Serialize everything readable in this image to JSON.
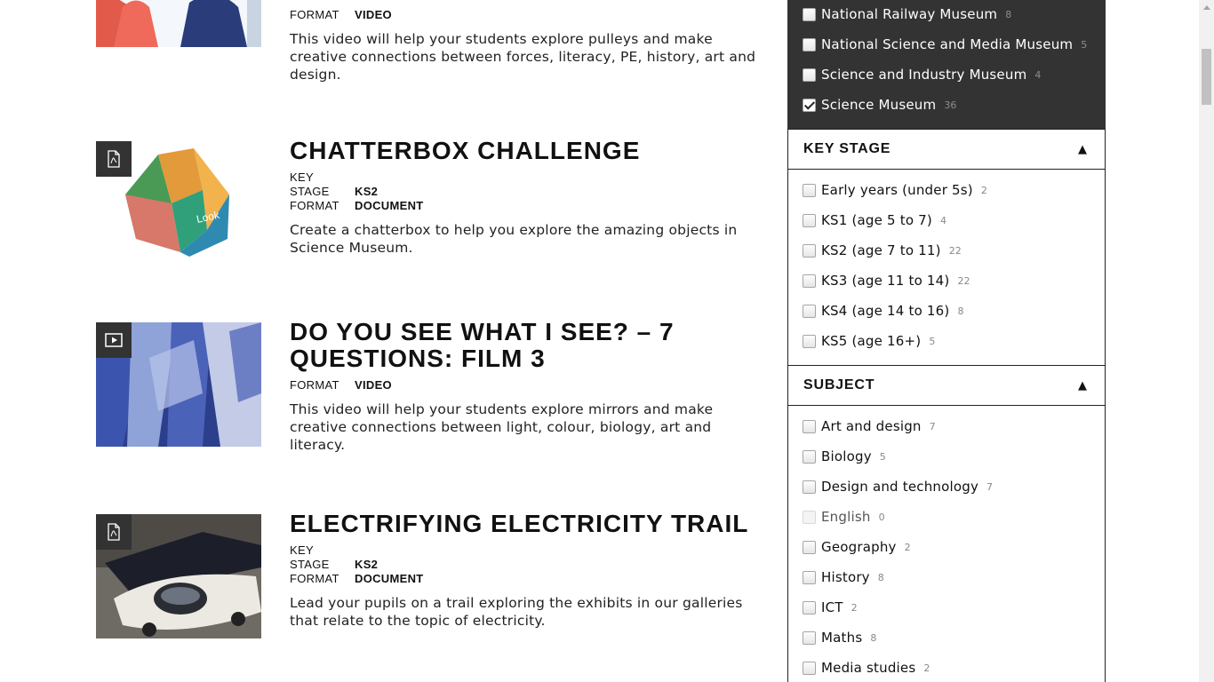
{
  "results": [
    {
      "title": "",
      "format_label": "FORMAT",
      "format": "VIDEO",
      "description": "This video will help your students explore pulleys and make creative connections between forces, literacy, PE, history, art and design."
    },
    {
      "title": "CHATTERBOX CHALLENGE",
      "key_stage_label": "KEY STAGE",
      "key_stage": "KS2",
      "format_label": "FORMAT",
      "format": "DOCUMENT",
      "description": "Create a chatterbox to help you explore the amazing objects in Science Museum.",
      "badge_icon": "pdf-icon",
      "thumb_words": [
        "Look"
      ]
    },
    {
      "title": "DO YOU SEE WHAT I SEE? – 7 QUESTIONS: FILM 3",
      "format_label": "FORMAT",
      "format": "VIDEO",
      "description": "This video will help your students explore mirrors and make creative connections between light, colour, biology, art and literacy.",
      "badge_icon": "video-play-icon"
    },
    {
      "title": "ELECTRIFYING ELECTRICITY TRAIL",
      "key_stage_label": "KEY STAGE",
      "key_stage": "KS2",
      "format_label": "FORMAT",
      "format": "DOCUMENT",
      "description": "Lead your pupils on a trail exploring the exhibits in our galleries that relate to the topic of electricity.",
      "badge_icon": "pdf-icon"
    }
  ],
  "museum_filters": [
    {
      "label": "National Railway Museum",
      "count": "8",
      "checked": false
    },
    {
      "label": "National Science and Media Museum",
      "count": "5",
      "checked": false
    },
    {
      "label": "Science and Industry Museum",
      "count": "4",
      "checked": false
    },
    {
      "label": "Science Museum",
      "count": "36",
      "checked": true
    }
  ],
  "key_stage": {
    "title": "KEY STAGE",
    "toggle": "▲",
    "items": [
      {
        "label": "Early years (under 5s)",
        "count": "2"
      },
      {
        "label": "KS1 (age 5 to 7)",
        "count": "4"
      },
      {
        "label": "KS2 (age 7 to 11)",
        "count": "22"
      },
      {
        "label": "KS3 (age 11 to 14)",
        "count": "22"
      },
      {
        "label": "KS4 (age 14 to 16)",
        "count": "8"
      },
      {
        "label": "KS5 (age 16+)",
        "count": "5"
      }
    ]
  },
  "subject": {
    "title": "SUBJECT",
    "toggle": "▲",
    "items": [
      {
        "label": "Art and design",
        "count": "7"
      },
      {
        "label": "Biology",
        "count": "5"
      },
      {
        "label": "Design and technology",
        "count": "7"
      },
      {
        "label": "English",
        "count": "0",
        "disabled": true
      },
      {
        "label": "Geography",
        "count": "2"
      },
      {
        "label": "History",
        "count": "8"
      },
      {
        "label": "ICT",
        "count": "2"
      },
      {
        "label": "Maths",
        "count": "8"
      },
      {
        "label": "Media studies",
        "count": "2"
      }
    ]
  },
  "colors": {
    "dark_panel": "#333333",
    "text": "#111111",
    "count": "#888888"
  }
}
